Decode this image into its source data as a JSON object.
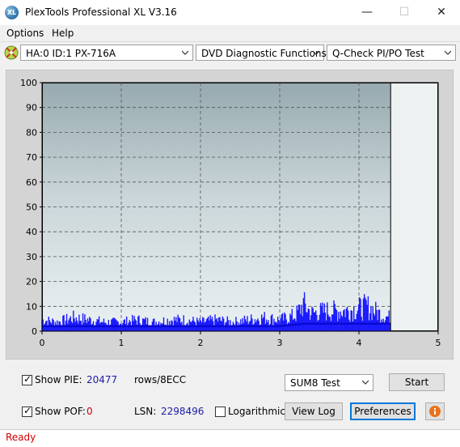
{
  "window": {
    "title": "PlexTools Professional XL V3.16",
    "icon_label": "XL"
  },
  "menu": {
    "items": [
      {
        "label": "Options"
      },
      {
        "label": "Help"
      }
    ]
  },
  "toolbar": {
    "drive": "HA:0 ID:1  PX-716A",
    "function": "DVD Diagnostic Functions",
    "test": "Q-Check PI/PO Test"
  },
  "controls": {
    "show_pie_label": "Show PIE:",
    "pie_value": "20477",
    "pie_unit": "rows/8ECC",
    "show_pof_label": "Show POF:",
    "pof_value": "0",
    "lsn_label": "LSN:",
    "lsn_value": "2298496",
    "logarithmic_label": "Logarithmic",
    "sum_select": "SUM8 Test",
    "start_label": "Start",
    "view_log_label": "View Log",
    "preferences_label": "Preferences",
    "show_pie_checked": true,
    "show_pof_checked": true,
    "logarithmic_checked": false
  },
  "status": {
    "text": "Ready"
  },
  "colors": {
    "pie": "#1a1aff",
    "status": "#d00000",
    "accent": "#0078d7"
  },
  "chart_data": {
    "type": "bar",
    "xlabel": "",
    "ylabel": "",
    "xlim": [
      0,
      5
    ],
    "ylim": [
      0,
      100
    ],
    "xticks": [
      "0",
      "1",
      "2",
      "3",
      "4",
      "5"
    ],
    "yticks": [
      "0",
      "10",
      "20",
      "30",
      "40",
      "50",
      "60",
      "70",
      "80",
      "90",
      "100"
    ],
    "grid": true,
    "end_marker_x": 4.4,
    "series": [
      {
        "values_x": [
          0.0,
          0.2,
          0.4,
          0.6,
          0.8,
          1.0,
          1.2,
          1.4,
          1.6,
          1.8,
          2.0,
          2.2,
          2.4,
          2.6,
          2.8,
          3.0,
          3.2,
          3.3,
          3.4,
          3.6,
          3.8,
          4.0,
          4.1,
          4.2,
          4.3,
          4.4
        ],
        "values_y": [
          5,
          4,
          6,
          5,
          4,
          4,
          5,
          4,
          5,
          5,
          4,
          5,
          4,
          5,
          6,
          5,
          7,
          12,
          8,
          9,
          9,
          10,
          11,
          9,
          7,
          6
        ]
      },
      {
        "values_x": [
          0.0,
          1.0,
          2.0,
          3.0,
          3.3,
          4.0,
          4.4
        ],
        "values_y": [
          2,
          2,
          2,
          2,
          3,
          3,
          3
        ]
      }
    ]
  }
}
